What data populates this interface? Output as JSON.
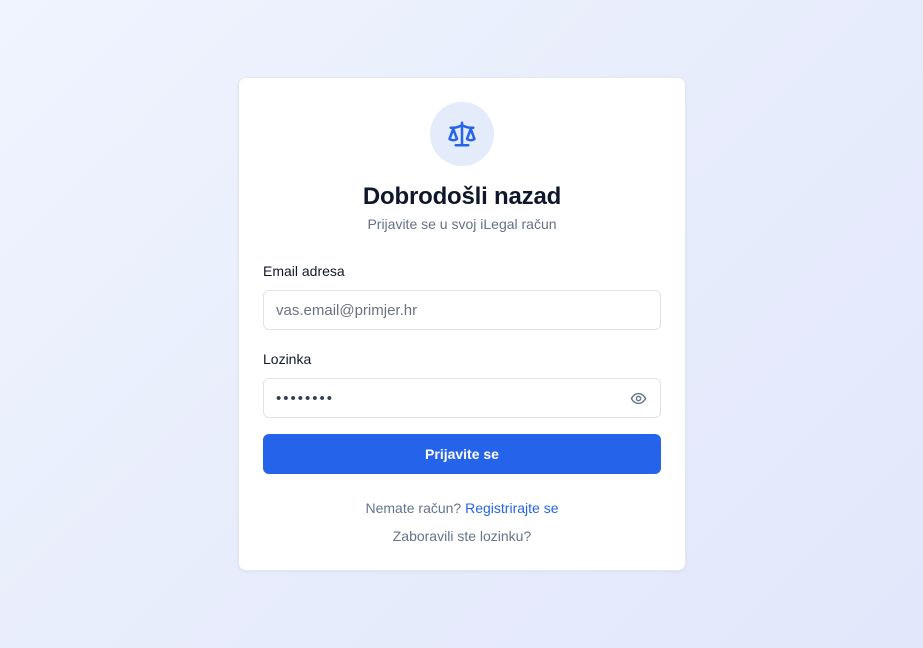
{
  "logo": {
    "icon": "scale-icon",
    "color": "#2563eb",
    "background": "#e4ebfb"
  },
  "header": {
    "title": "Dobrodošli nazad",
    "subtitle": "Prijavite se u svoj iLegal račun"
  },
  "form": {
    "email": {
      "label": "Email adresa",
      "placeholder": "vas.email@primjer.hr",
      "value": ""
    },
    "password": {
      "label": "Lozinka",
      "masked_value": "••••••••",
      "toggle_icon": "eye-icon"
    },
    "submit_label": "Prijavite se"
  },
  "footer": {
    "register_prompt": "Nemate račun?",
    "register_link": "Registrirajte se",
    "forgot_link": "Zaboravili ste lozinku?"
  },
  "colors": {
    "accent": "#2563eb",
    "text": "#0f172a",
    "muted": "#64748b"
  }
}
